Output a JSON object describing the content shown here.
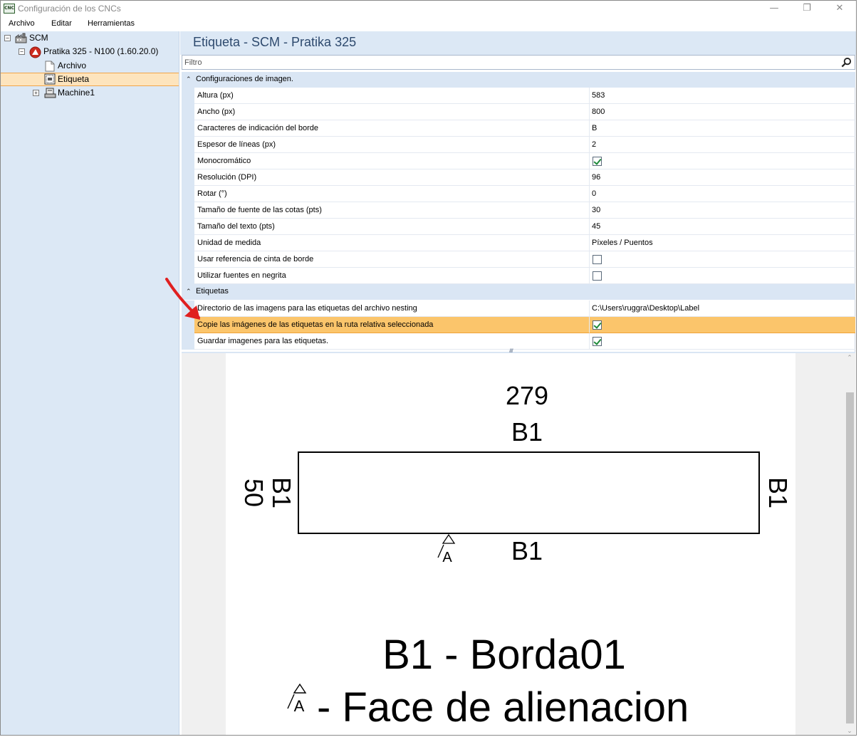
{
  "window": {
    "title": "Configuración de los CNCs",
    "icon_text": "CNC",
    "controls": {
      "minimize": "—",
      "restore": "❐",
      "close": "✕"
    }
  },
  "menu": [
    "Archivo",
    "Editar",
    "Herramientas"
  ],
  "tree": {
    "root": {
      "label": "SCM",
      "icon": "factory-icon",
      "expander": "⊟"
    },
    "machine": {
      "label": "Pratika 325 - N100 (1.60.20.0)",
      "icon": "scm-logo-icon",
      "expander": "⊟"
    },
    "children": [
      {
        "label": "Archivo",
        "icon": "file-icon",
        "selected": false
      },
      {
        "label": "Etiqueta",
        "icon": "label-icon",
        "selected": true
      }
    ],
    "machine1": {
      "label": "Machine1",
      "icon": "machine-icon",
      "expander": "⊞"
    }
  },
  "main": {
    "title": "Etiqueta - SCM - Pratika 325",
    "filter_placeholder": "Filtro"
  },
  "grid": {
    "categories": [
      {
        "label": "Configuraciones de imagen.",
        "toggle": "⌃",
        "rows": [
          {
            "name": "Altura (px)",
            "value": "583",
            "type": "text"
          },
          {
            "name": "Ancho (px)",
            "value": "800",
            "type": "text"
          },
          {
            "name": "Caracteres de indicación del borde",
            "value": "B",
            "type": "text"
          },
          {
            "name": "Espesor de líneas (px)",
            "value": "2",
            "type": "text"
          },
          {
            "name": "Monocromático",
            "value": "",
            "type": "check",
            "checked": true
          },
          {
            "name": "Resolución (DPI)",
            "value": "96",
            "type": "text"
          },
          {
            "name": "Rotar (°)",
            "value": "0",
            "type": "text"
          },
          {
            "name": "Tamaño de fuente de las cotas (pts)",
            "value": "30",
            "type": "text"
          },
          {
            "name": "Tamaño del texto (pts)",
            "value": "45",
            "type": "text"
          },
          {
            "name": "Unidad de medida",
            "value": "Píxeles / Puentos",
            "type": "text"
          },
          {
            "name": "Usar referencia de cinta de borde",
            "value": "",
            "type": "check",
            "checked": false
          },
          {
            "name": "Utilizar fuentes en negrita",
            "value": "",
            "type": "check",
            "checked": false
          }
        ]
      },
      {
        "label": "Etiquetas",
        "toggle": "⌃",
        "rows": [
          {
            "name": "Directorio de las imagens para las etiquetas del archivo nesting",
            "value": "C:\\Users\\ruggra\\Desktop\\Label",
            "type": "text"
          },
          {
            "name": "Copie las imágenes de las etiquetas en la ruta relativa seleccionada",
            "value": "",
            "type": "check",
            "checked": true,
            "selected": true
          },
          {
            "name": "Guardar imagenes para las etiquetas.",
            "value": "",
            "type": "check",
            "checked": true
          }
        ]
      }
    ]
  },
  "preview": {
    "dimension_top": "279",
    "edge_top": "B1",
    "dimension_left": "50",
    "edge_left": "B1",
    "edge_right": "B1",
    "edge_bottom": "B1",
    "alignment_symbol_top": "A",
    "alignment_symbol_bottom": "A",
    "legend_edge": "B1 - Borda01",
    "legend_face": "- Face de alienacion"
  },
  "annotation": {
    "arrow_color": "#e02020"
  },
  "colors": {
    "panel_bg": "#dce8f5",
    "category_bg": "#dae6f4",
    "selection_bg": "#fbc56b",
    "tree_selection_bg": "#fde4bd",
    "title_color": "#2e4a6e"
  }
}
